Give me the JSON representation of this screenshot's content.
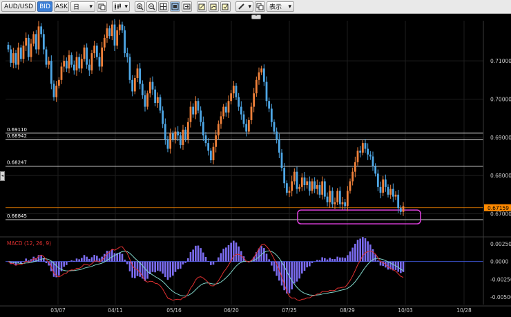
{
  "toolbar": {
    "symbol": "AUD/USD",
    "bid_label": "BID",
    "ask_label": "ASK",
    "period": "日",
    "dropdown_arrow": "▾",
    "display_label": "表示"
  },
  "collapse_glyph": "⌃",
  "expand_glyph": "◂",
  "chart_data": [
    {
      "type": "candlestick",
      "ylim": [
        0.6645,
        0.7205
      ],
      "price_ticks": [
        "0.71000",
        "0.70000",
        "0.69000",
        "0.68000",
        "0.67000"
      ],
      "date_ticks": [
        "03/07",
        "04/11",
        "05/16",
        "06/20",
        "07/25",
        "08/29",
        "10/03",
        "10/28"
      ],
      "horizontal_lines": [
        {
          "label": "0.69110",
          "value": 0.6911
        },
        {
          "label": "0.68942",
          "value": 0.68942
        },
        {
          "label": "0.68247",
          "value": 0.68247
        },
        {
          "label": "0.66845",
          "value": 0.66845
        }
      ],
      "current_price": {
        "label": "0.67159",
        "value": 0.67159
      },
      "colors": {
        "up": "#f0813a",
        "down": "#4ea7e6",
        "current": "#ff8a00",
        "highlight": "#e040e0"
      },
      "closes": [
        0.713,
        0.7095,
        0.712,
        0.709,
        0.7135,
        0.7105,
        0.714,
        0.716,
        0.711,
        0.7145,
        0.717,
        0.713,
        0.719,
        0.717,
        0.713,
        0.709,
        0.71,
        0.704,
        0.7005,
        0.7035,
        0.705,
        0.7085,
        0.71,
        0.708,
        0.7115,
        0.709,
        0.7075,
        0.711,
        0.708,
        0.7105,
        0.7135,
        0.709,
        0.7075,
        0.712,
        0.714,
        0.711,
        0.7085,
        0.7135,
        0.716,
        0.7185,
        0.7165,
        0.7195,
        0.714,
        0.718,
        0.7195,
        0.718,
        0.712,
        0.711,
        0.705,
        0.702,
        0.7055,
        0.708,
        0.704,
        0.701,
        0.698,
        0.7015,
        0.7045,
        0.7025,
        0.699,
        0.7005,
        0.697,
        0.6935,
        0.6895,
        0.687,
        0.691,
        0.6895,
        0.6915,
        0.6905,
        0.688,
        0.692,
        0.6895,
        0.694,
        0.698,
        0.696,
        0.6995,
        0.697,
        0.694,
        0.6905,
        0.6885,
        0.6865,
        0.684,
        0.6875,
        0.6905,
        0.6935,
        0.6955,
        0.698,
        0.6965,
        0.6995,
        0.7015,
        0.7035,
        0.7005,
        0.698,
        0.696,
        0.6935,
        0.6915,
        0.6945,
        0.698,
        0.7015,
        0.705,
        0.707,
        0.708,
        0.7045,
        0.6995,
        0.6975,
        0.694,
        0.6915,
        0.6895,
        0.686,
        0.682,
        0.678,
        0.6755,
        0.676,
        0.6785,
        0.681,
        0.6765,
        0.677,
        0.6795,
        0.6775,
        0.6785,
        0.676,
        0.6785,
        0.6765,
        0.6775,
        0.675,
        0.6785,
        0.6745,
        0.673,
        0.676,
        0.6725,
        0.673,
        0.676,
        0.6725,
        0.673,
        0.672,
        0.676,
        0.6785,
        0.681,
        0.6835,
        0.6865,
        0.686,
        0.6885,
        0.687,
        0.6855,
        0.685,
        0.6825,
        0.6805,
        0.677,
        0.6755,
        0.679,
        0.677,
        0.675,
        0.6765,
        0.6745,
        0.675,
        0.6715,
        0.6705,
        0.672
      ]
    },
    {
      "type": "histogram",
      "title": "MACD (12, 26, 9)",
      "ylim": [
        -0.0058,
        0.003
      ],
      "ticks": [
        "0.00250",
        "0.0000",
        "-0.00250",
        "-0.00500"
      ],
      "colors": {
        "hist": "#7b6cf0",
        "macd": "#e03030",
        "signal": "#7fd4c8"
      }
    }
  ]
}
